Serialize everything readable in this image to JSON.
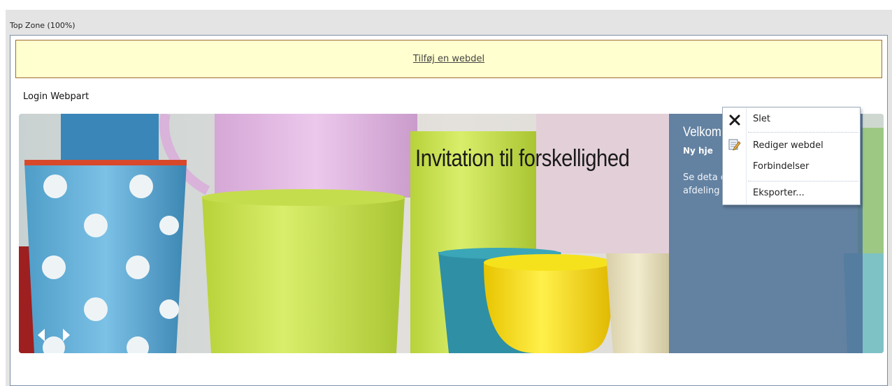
{
  "zone": {
    "title": "Top Zone (100%)"
  },
  "add_webpart": {
    "label": "Tilføj en webdel"
  },
  "webpart": {
    "title": "Login Webpart"
  },
  "banner": {
    "headline": "Invitation til forskellighed",
    "panel_heading": "Velkom",
    "panel_sub": "Ny hje",
    "panel_body": "Se deta og hold der rører sig i din afdeling og i Domea.",
    "prev_icon": "chevron-left-icon",
    "next_icon": "chevron-right-icon"
  },
  "context_menu": {
    "items": [
      {
        "label": "Slet",
        "icon": "close-icon"
      },
      {
        "label": "Rediger webdel",
        "icon": "edit-icon"
      },
      {
        "label": "Forbindelser",
        "icon": ""
      },
      {
        "label": "Eksporter...",
        "icon": ""
      }
    ]
  },
  "colors": {
    "zone_background": "#e4e4e4",
    "add_webpart_fill": "#ffffcf",
    "add_webpart_border": "#a06a30",
    "panel_blue": "#4a6e96"
  }
}
